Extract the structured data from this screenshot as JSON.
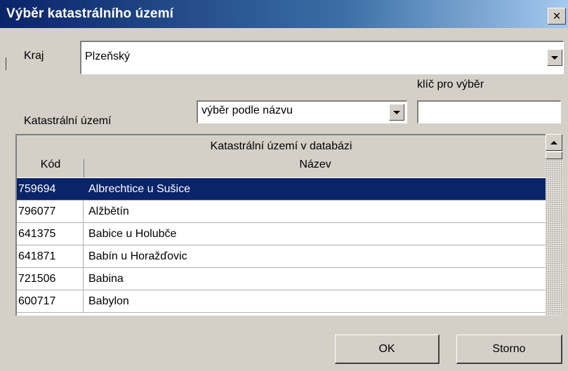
{
  "window": {
    "title": "Výběr katastrálního území",
    "close_label": "×"
  },
  "kraj": {
    "label": "Kraj",
    "value": "Plzeňský"
  },
  "filter": {
    "label": "Katastrální území",
    "mode_value": "výběr podle názvu",
    "key_label": "klíč pro výběr",
    "key_value": ""
  },
  "grid": {
    "title": "Katastrální území v databázi",
    "columns": [
      "Kód",
      "Název"
    ],
    "rows": [
      {
        "kod": "759694",
        "nazev": "Albrechtice u Sušice",
        "selected": true
      },
      {
        "kod": "796077",
        "nazev": "Alžbětín",
        "selected": false
      },
      {
        "kod": "641375",
        "nazev": "Babice u Holubče",
        "selected": false
      },
      {
        "kod": "641871",
        "nazev": "Babín u Horažďovic",
        "selected": false
      },
      {
        "kod": "721506",
        "nazev": "Babina",
        "selected": false
      },
      {
        "kod": "600717",
        "nazev": "Babylon",
        "selected": false
      }
    ]
  },
  "buttons": {
    "ok": "OK",
    "cancel": "Storno"
  },
  "colors": {
    "title_bar": "#0a246a",
    "selection": "#0a246a",
    "face": "#d4d0c8"
  }
}
